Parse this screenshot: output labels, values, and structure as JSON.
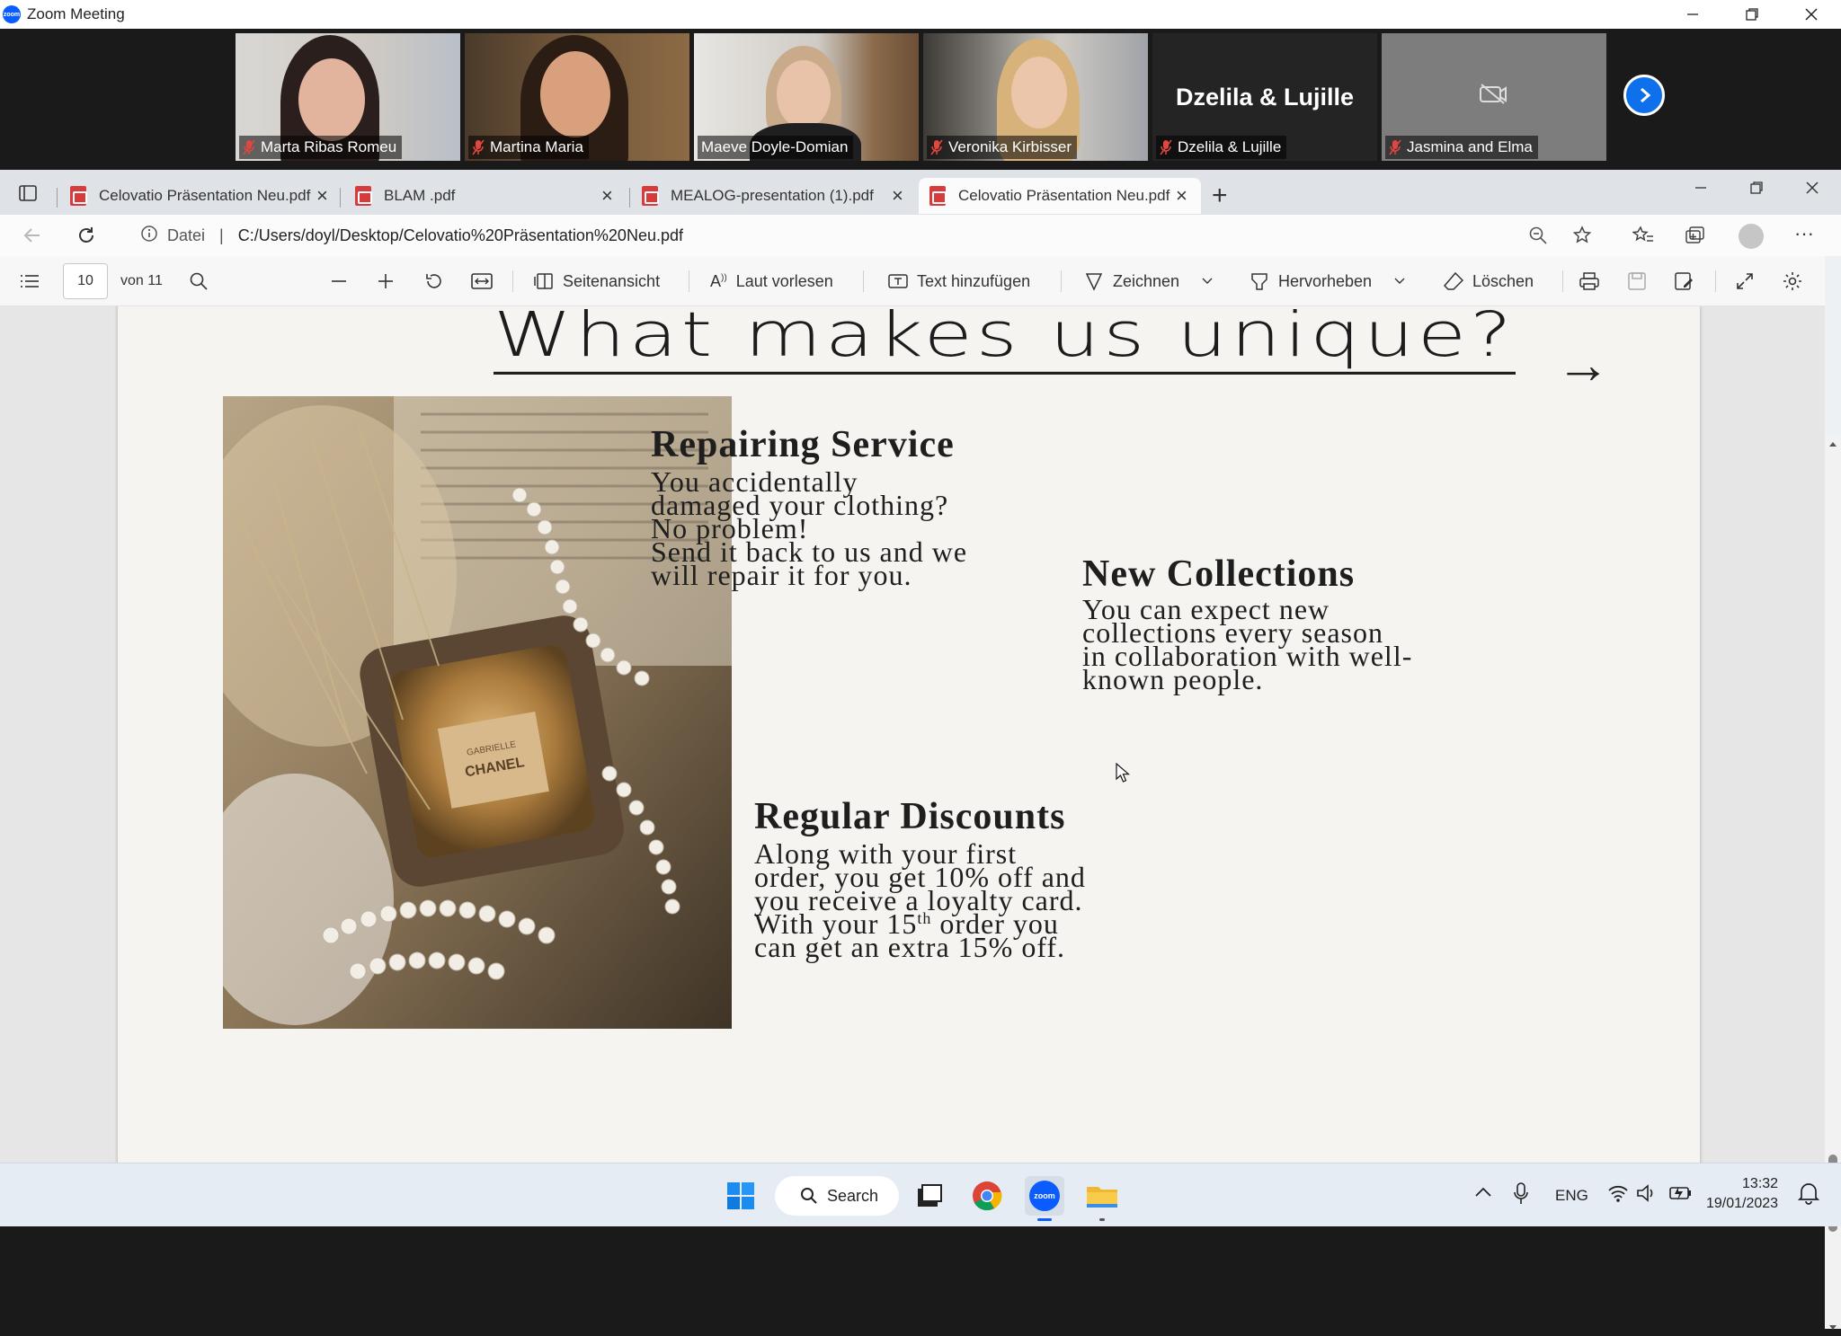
{
  "zoom": {
    "window_title": "Zoom Meeting",
    "participants": [
      {
        "name": "Marta Ribas Romeu",
        "muted": true
      },
      {
        "name": "Martina Maria",
        "muted": true
      },
      {
        "name": "Maeve Doyle-Domian",
        "muted": false,
        "active_speaker": true
      },
      {
        "name": "Veronika Kirbisser",
        "muted": true
      },
      {
        "name": "Dzelila & Lujille",
        "muted": true,
        "video_off": true,
        "display_label": "Dzelila & Lujille"
      },
      {
        "name": "Jasmina and Elma",
        "muted": true,
        "video_off": true
      }
    ]
  },
  "browser": {
    "tabs": [
      {
        "label": "Celovatio Präsentation Neu.pdf",
        "active": false
      },
      {
        "label": "BLAM .pdf",
        "active": false
      },
      {
        "label": "MEALOG-presentation (1).pdf",
        "active": false
      },
      {
        "label": "Celovatio Präsentation Neu.pdf",
        "active": true
      }
    ],
    "address": {
      "scheme_label": "Datei",
      "url": "C:/Users/doyl/Desktop/Celovatio%20Präsentation%20Neu.pdf"
    },
    "pdf_toolbar": {
      "page_current": "10",
      "page_total_label": "von 11",
      "page_view": "Seitenansicht",
      "read_aloud": "Laut vorlesen",
      "add_text": "Text hinzufügen",
      "draw": "Zeichnen",
      "highlight": "Hervorheben",
      "erase": "Löschen"
    }
  },
  "slide": {
    "title": "What makes us unique?",
    "arrow": "→",
    "sections": {
      "repair": {
        "title": "Repairing Service",
        "lines": [
          "You accidentally",
          "damaged your clothing?",
          "No problem!",
          "Send it back to us and we",
          "will repair it for you."
        ]
      },
      "collections": {
        "title": "New Collections",
        "lines": [
          "You can expect new",
          "collections every season",
          "in collaboration with well-",
          "known people."
        ]
      },
      "discounts": {
        "title": "Regular Discounts",
        "lines": [
          "Along with your first",
          "order, you get 10% off and",
          "you receive a loyalty card."
        ],
        "line4_pre": "With your 15",
        "line4_sup": "th",
        "line4_post": " order you",
        "line5": "can get an extra 15% off."
      }
    },
    "photo_label": {
      "line1": "GABRIELLE",
      "line2": "CHANEL"
    }
  },
  "taskbar": {
    "search_label": "Search",
    "language": "ENG",
    "time": "13:32",
    "date": "19/01/2023"
  },
  "colors": {
    "zoom_blue": "#0b5cff",
    "active_speaker_border": "#78c35a",
    "pdf_red": "#d83b3b",
    "slide_bg": "#f5f4f1"
  }
}
